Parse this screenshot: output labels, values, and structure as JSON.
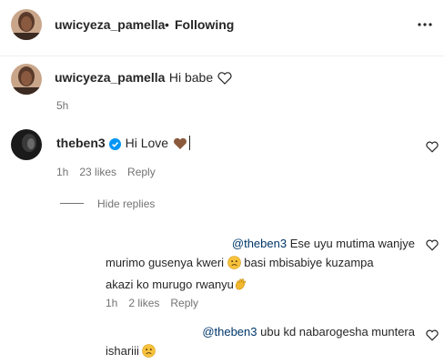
{
  "header": {
    "username": "uwicyeza_pamella",
    "dot": "•",
    "follow_label": "Following",
    "more_icon": "more-horizontal-icon"
  },
  "caption": {
    "username": "uwicyeza_pamella",
    "text": "Hi babe",
    "time": "5h"
  },
  "comment1": {
    "username": "theben3",
    "verified": true,
    "text": "Hi Love",
    "time": "1h",
    "likes": "23 likes",
    "reply": "Reply",
    "hide_replies": "Hide replies"
  },
  "reply1": {
    "mention": "@theben3",
    "line1": "Ese uyu mutima wanjye",
    "line2a": "murimo gusenya kweri",
    "line2b": "basi mbisabiye kuzampa",
    "line3": "akazi ko murugo rwanyu",
    "time": "1h",
    "likes": "2 likes",
    "reply": "Reply"
  },
  "reply2": {
    "mention": "@theben3",
    "line1": "ubu kd nabarogesha muntera",
    "line2": "ishariii"
  },
  "colors": {
    "text": "#262626",
    "secondary": "#737373",
    "mention": "#00376b",
    "verified": "#0095f6",
    "brown_heart": "#8b5a3c"
  }
}
